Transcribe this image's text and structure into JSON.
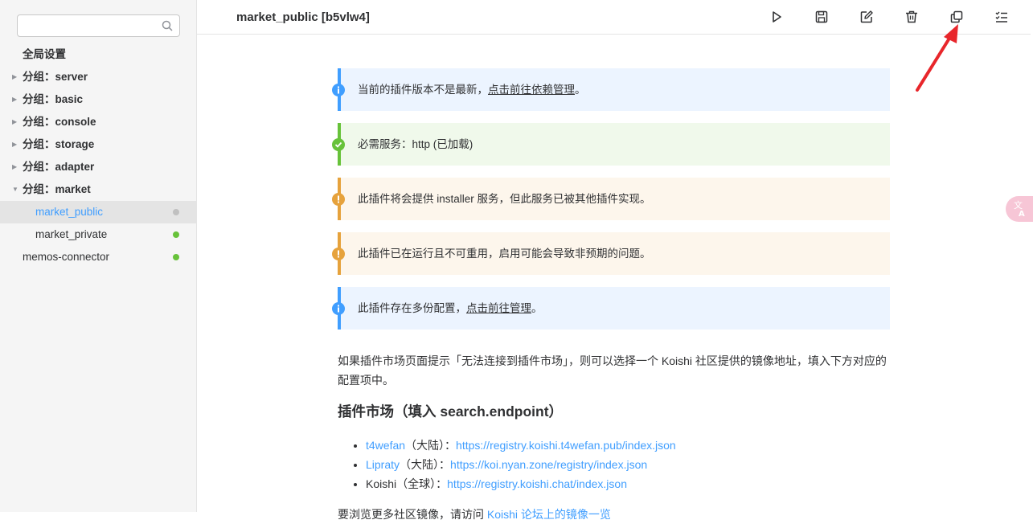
{
  "sidebar": {
    "search": {
      "placeholder": "",
      "value": ""
    },
    "global_settings": "全局设置",
    "groups": [
      {
        "label": "分组：server",
        "expanded": false
      },
      {
        "label": "分组：basic",
        "expanded": false
      },
      {
        "label": "分组：console",
        "expanded": false
      },
      {
        "label": "分组：storage",
        "expanded": false
      },
      {
        "label": "分组：adapter",
        "expanded": false
      },
      {
        "label": "分组：market",
        "expanded": true
      }
    ],
    "market_children": [
      {
        "label": "market_public",
        "status_color": "#c0c0c0",
        "active": true
      },
      {
        "label": "market_private",
        "status_color": "#67c23a",
        "active": false
      }
    ],
    "standalone": {
      "label": "memos-connector",
      "status_color": "#67c23a"
    }
  },
  "header": {
    "title": "market_public [b5vlw4]",
    "tools": [
      "play-icon",
      "save-icon",
      "edit-icon",
      "trash-icon",
      "copy-icon",
      "checklist-icon"
    ]
  },
  "notices": [
    {
      "type": "info",
      "text": "当前的插件版本不是最新，",
      "link": "点击前往依赖管理",
      "suffix": "。"
    },
    {
      "type": "success",
      "text": "必需服务：http (已加载)",
      "link": "",
      "suffix": ""
    },
    {
      "type": "warn",
      "text": "此插件将会提供 installer 服务，但此服务已被其他插件实现。",
      "link": "",
      "suffix": ""
    },
    {
      "type": "warn",
      "text": "此插件已在运行且不可重用，启用可能会导致非预期的问题。",
      "link": "",
      "suffix": ""
    },
    {
      "type": "info",
      "text": "此插件存在多份配置，",
      "link": "点击前往管理",
      "suffix": "。"
    }
  ],
  "intro": "如果插件市场页面提示「无法连接到插件市场」，则可以选择一个 Koishi 社区提供的镜像地址，填入下方对应的配置项中。",
  "section_title": "插件市场（填入 search.endpoint）",
  "mirrors": [
    {
      "name": "t4wefan",
      "name_is_link": true,
      "region": "（大陆）：",
      "url": "https://registry.koishi.t4wefan.pub/index.json"
    },
    {
      "name": "Lipraty",
      "name_is_link": true,
      "region": "（大陆）：",
      "url": "https://koi.nyan.zone/registry/index.json"
    },
    {
      "name": "Koishi",
      "name_is_link": false,
      "region": "（全球）：",
      "url": "https://registry.koishi.chat/index.json"
    }
  ],
  "more": {
    "text": "要浏览更多社区镜像，请访问 ",
    "link": "Koishi 论坛上的镜像一览"
  },
  "colors": {
    "accent": "#409eff",
    "success": "#67c23a",
    "warning": "#e6a23c",
    "arrow": "#e8262b"
  }
}
